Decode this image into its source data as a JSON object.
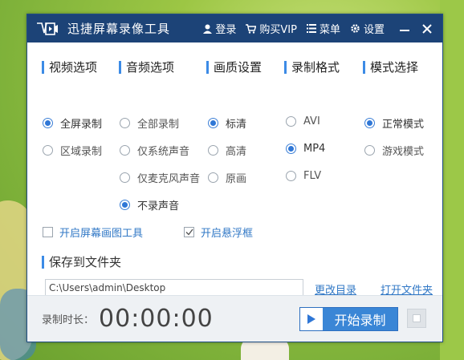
{
  "app": {
    "title": "迅捷屏幕录像工具"
  },
  "titlebar": {
    "login": "登录",
    "buy_vip": "购买VIP",
    "menu": "菜单",
    "settings": "设置"
  },
  "sections": {
    "video": {
      "heading": "视频选项",
      "options": [
        {
          "label": "全屏录制",
          "selected": true
        },
        {
          "label": "区域录制",
          "selected": false
        }
      ]
    },
    "audio": {
      "heading": "音频选项",
      "options": [
        {
          "label": "全部录制",
          "selected": false
        },
        {
          "label": "仅系统声音",
          "selected": false
        },
        {
          "label": "仅麦克风声音",
          "selected": false
        },
        {
          "label": "不录声音",
          "selected": true
        }
      ]
    },
    "quality": {
      "heading": "画质设置",
      "options": [
        {
          "label": "标清",
          "selected": true
        },
        {
          "label": "高清",
          "selected": false
        },
        {
          "label": "原画",
          "selected": false
        }
      ]
    },
    "format": {
      "heading": "录制格式",
      "options": [
        {
          "label": "AVI",
          "selected": false
        },
        {
          "label": "MP4",
          "selected": true
        },
        {
          "label": "FLV",
          "selected": false
        }
      ]
    },
    "mode": {
      "heading": "模式选择",
      "options": [
        {
          "label": "正常模式",
          "selected": true
        },
        {
          "label": "游戏模式",
          "selected": false
        }
      ]
    }
  },
  "checkboxes": {
    "screen_draw": {
      "label": "开启屏幕画图工具",
      "checked": false
    },
    "float_frame": {
      "label": "开启悬浮框",
      "checked": true
    }
  },
  "save": {
    "heading": "保存到文件夹",
    "path": "C:\\Users\\admin\\Desktop",
    "change_dir": "更改目录",
    "open_folder": "打开文件夹"
  },
  "footer": {
    "time_label": "录制时长：",
    "time_value": "00:00:00",
    "start_label": "开始录制"
  },
  "colors": {
    "titlebar": "#1c4377",
    "accent": "#3a86d6",
    "link": "#3178c6"
  }
}
